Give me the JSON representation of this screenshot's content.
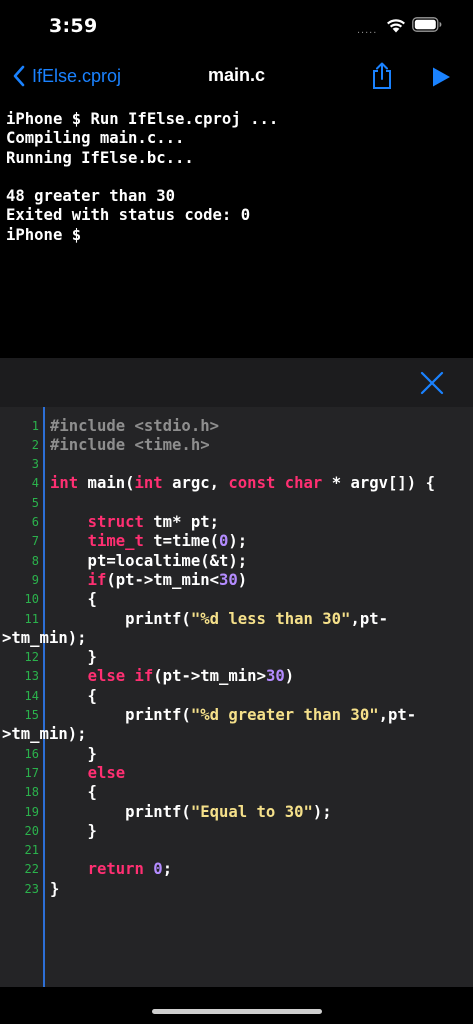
{
  "status_bar": {
    "time": "3:59",
    "signal": "....."
  },
  "nav": {
    "back_label": "IfElse.cproj",
    "title": "main.c"
  },
  "console": {
    "lines": [
      "iPhone $ Run IfElse.cproj ...",
      "Compiling main.c...",
      "Running IfElse.bc...",
      "",
      "48 greater than 30",
      "Exited with status code: 0",
      "iPhone $"
    ]
  },
  "editor": {
    "lines": [
      {
        "n": "1",
        "tokens": [
          [
            "pre",
            "#include <stdio.h>"
          ]
        ]
      },
      {
        "n": "2",
        "tokens": [
          [
            "pre",
            "#include <time.h>"
          ]
        ]
      },
      {
        "n": "3",
        "tokens": []
      },
      {
        "n": "4",
        "tokens": [
          [
            "kw",
            "int"
          ],
          [
            "plain",
            " main("
          ],
          [
            "kw",
            "int"
          ],
          [
            "plain",
            " argc, "
          ],
          [
            "kw",
            "const"
          ],
          [
            "plain",
            " "
          ],
          [
            "kw",
            "char"
          ],
          [
            "plain",
            " * argv[]) {"
          ]
        ]
      },
      {
        "n": "5",
        "tokens": []
      },
      {
        "n": "6",
        "tokens": [
          [
            "plain",
            "    "
          ],
          [
            "kw",
            "struct"
          ],
          [
            "plain",
            " tm* pt;"
          ]
        ]
      },
      {
        "n": "7",
        "tokens": [
          [
            "plain",
            "    "
          ],
          [
            "kw",
            "time_t"
          ],
          [
            "plain",
            " t=time("
          ],
          [
            "num",
            "0"
          ],
          [
            "plain",
            ");"
          ]
        ]
      },
      {
        "n": "8",
        "tokens": [
          [
            "plain",
            "    pt=localtime(&t);"
          ]
        ]
      },
      {
        "n": "9",
        "tokens": [
          [
            "plain",
            "    "
          ],
          [
            "kw",
            "if"
          ],
          [
            "plain",
            "(pt->tm_min<"
          ],
          [
            "num",
            "30"
          ],
          [
            "plain",
            ")"
          ]
        ]
      },
      {
        "n": "10",
        "tokens": [
          [
            "plain",
            "    {"
          ]
        ]
      },
      {
        "n": "11",
        "tokens": [
          [
            "plain",
            "        printf("
          ],
          [
            "str",
            "\"%d less than 30\""
          ],
          [
            "plain",
            ",pt-"
          ]
        ],
        "cont": ">tm_min);"
      },
      {
        "n": "12",
        "tokens": [
          [
            "plain",
            "    }"
          ]
        ]
      },
      {
        "n": "13",
        "tokens": [
          [
            "plain",
            "    "
          ],
          [
            "kw",
            "else"
          ],
          [
            "plain",
            " "
          ],
          [
            "kw",
            "if"
          ],
          [
            "plain",
            "(pt->tm_min>"
          ],
          [
            "num",
            "30"
          ],
          [
            "plain",
            ")"
          ]
        ]
      },
      {
        "n": "14",
        "tokens": [
          [
            "plain",
            "    {"
          ]
        ]
      },
      {
        "n": "15",
        "tokens": [
          [
            "plain",
            "        printf("
          ],
          [
            "str",
            "\"%d greater than 30\""
          ],
          [
            "plain",
            ",pt-"
          ]
        ],
        "cont": ">tm_min);"
      },
      {
        "n": "16",
        "tokens": [
          [
            "plain",
            "    }"
          ]
        ]
      },
      {
        "n": "17",
        "tokens": [
          [
            "plain",
            "    "
          ],
          [
            "kw",
            "else"
          ]
        ]
      },
      {
        "n": "18",
        "tokens": [
          [
            "plain",
            "    {"
          ]
        ]
      },
      {
        "n": "19",
        "tokens": [
          [
            "plain",
            "        printf("
          ],
          [
            "str",
            "\"Equal to 30\""
          ],
          [
            "plain",
            ");"
          ]
        ]
      },
      {
        "n": "20",
        "tokens": [
          [
            "plain",
            "    }"
          ]
        ]
      },
      {
        "n": "21",
        "tokens": []
      },
      {
        "n": "22",
        "tokens": [
          [
            "plain",
            "    "
          ],
          [
            "kw",
            "return"
          ],
          [
            "plain",
            " "
          ],
          [
            "num",
            "0"
          ],
          [
            "plain",
            ";"
          ]
        ]
      },
      {
        "n": "23",
        "tokens": [
          [
            "plain",
            "}"
          ]
        ]
      }
    ]
  },
  "icons": {
    "back": "chevron-left-icon",
    "share": "share-icon",
    "run": "play-icon",
    "close": "close-icon",
    "wifi": "wifi-icon",
    "battery": "battery-icon"
  },
  "colors": {
    "accent": "#1a82ff",
    "keyword": "#ff2f72",
    "number": "#b48cff",
    "string": "#f5e08a",
    "preprocessor": "#8e8e8e",
    "line_number": "#2bb24c",
    "gutter": "#2d6fd6"
  }
}
